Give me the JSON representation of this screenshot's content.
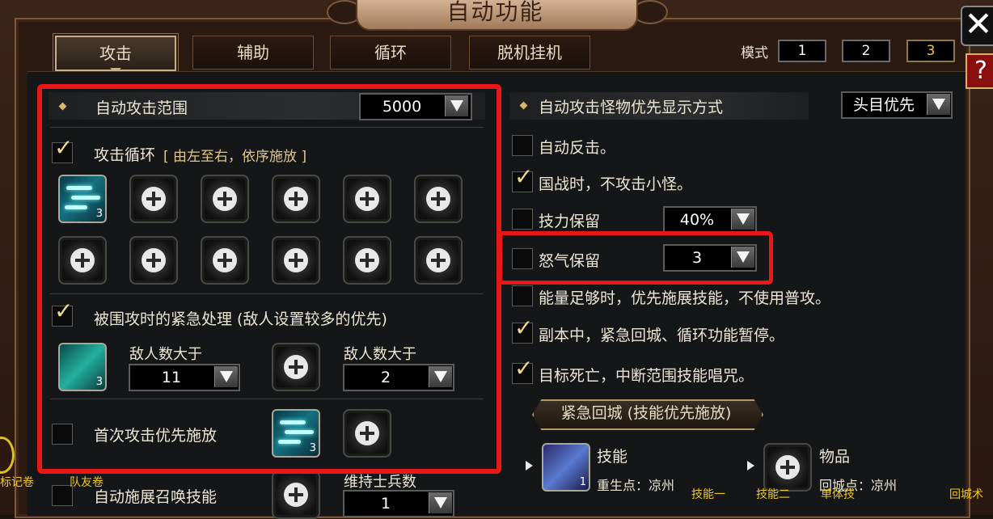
{
  "title": "自动功能",
  "close_icon": "close-icon",
  "help_label": "?",
  "tabs": [
    "攻击",
    "辅助",
    "循环",
    "脱机挂机"
  ],
  "mode": {
    "label": "模式",
    "options": [
      "1",
      "2",
      "3"
    ],
    "active": "3"
  },
  "left": {
    "attack_range": {
      "label": "自动攻击范围",
      "value": "5000"
    },
    "attack_cycle": {
      "checked": true,
      "label": "攻击循环",
      "note": "[ 由左至右，依序施放 ]",
      "skill_count": "3"
    },
    "emergency": {
      "checked": true,
      "label": "被围攻时的紧急处理 (敌人设置较多的优先)",
      "skill_count": "3",
      "enemy_label_1": "敌人数大于",
      "enemy_value_1": "11",
      "enemy_label_2": "敌人数大于",
      "enemy_value_2": "2"
    },
    "first_attack": {
      "checked": false,
      "label": "首次攻击优先施放",
      "skill_count": "3"
    },
    "summon": {
      "checked": false,
      "label": "自动施展召唤技能",
      "keep_label": "维持士兵数",
      "keep_value": "1"
    }
  },
  "right": {
    "priority": {
      "label": "自动攻击怪物优先显示方式",
      "value": "头目优先"
    },
    "counter": {
      "checked": false,
      "label": "自动反击。"
    },
    "nation_war": {
      "checked": true,
      "label": "国战时，不攻击小怪。"
    },
    "skill_reserve": {
      "checked": false,
      "label": "技力保留",
      "value": "40%"
    },
    "rage_reserve": {
      "checked": false,
      "label": "怒气保留",
      "value": "3"
    },
    "energy": {
      "checked": false,
      "label": "能量足够时，优先施展技能，不使用普攻。"
    },
    "dungeon": {
      "checked": true,
      "label": "副本中，紧急回城、循环功能暂停。"
    },
    "target_dead": {
      "checked": true,
      "label": "目标死亡，中断范围技能唱咒。"
    },
    "emergency_return": {
      "banner": "紧急回城 (技能优先施放)",
      "skill_label": "技能",
      "skill_sub": "重生点：凉州",
      "skill_count": "1",
      "item_label": "物品",
      "item_sub": "回城点：凉州"
    }
  },
  "underlay": {
    "left_text_1": "标记卷",
    "left_text_2": "队友卷",
    "bottom_1": "技能一",
    "bottom_2": "技能二",
    "bottom_3": "单体技",
    "bottom_4": "回城术"
  }
}
